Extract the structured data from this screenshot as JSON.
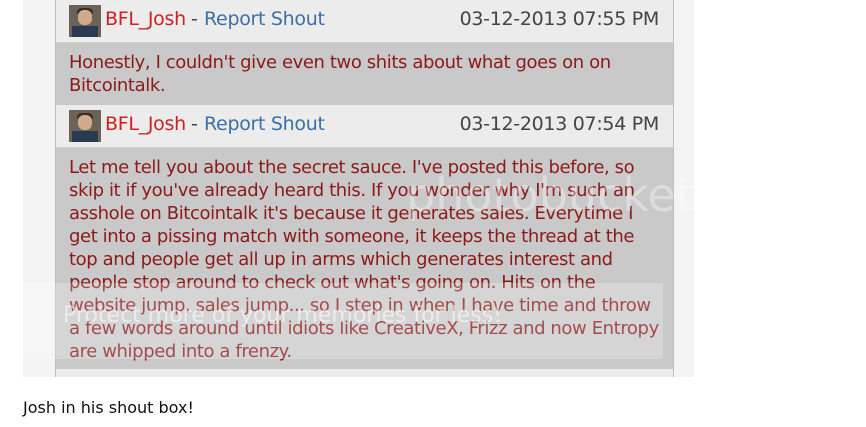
{
  "shouts": [
    {
      "user": "BFL_Josh",
      "separator": "-",
      "action": "Report Shout",
      "timestamp": "03-12-2013 07:55 PM",
      "message": "Honestly, I couldn't give even two shits about what goes on on Bitcointalk."
    },
    {
      "user": "BFL_Josh",
      "separator": "-",
      "action": "Report Shout",
      "timestamp": "03-12-2013 07:54 PM",
      "message": "Let me tell you about the secret sauce. I've posted this before, so skip it if you've already heard this. If you wonder why I'm such an asshole on Bitcointalk it's because it generates sales. Everytime I get into a pissing match with someone, it keeps the thread at the top and people get all up in arms which generates interest and people stop around to check out what's going on. Hits on the website jump, sales jump... so I step in when I have time and throw a few words around until idiots like CreativeX, Frizz and now Entropy are whipped into a frenzy."
    }
  ],
  "watermark": {
    "logo": "photobucket",
    "text": "Protect more of your memories for less!"
  },
  "caption": "Josh in his shout box!"
}
